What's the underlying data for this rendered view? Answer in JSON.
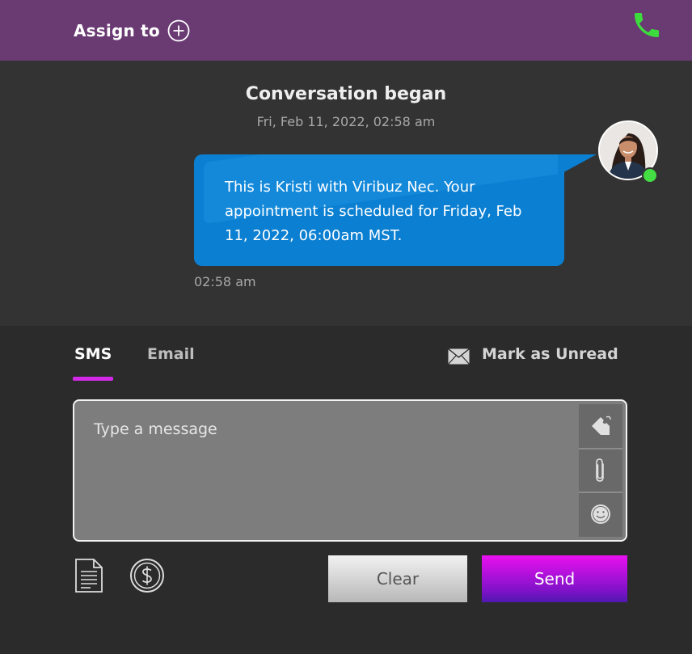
{
  "header": {
    "assign_label": "Assign to",
    "add_icon": "plus-circle-icon",
    "call_icon": "phone-icon",
    "call_color": "#3ddc3d",
    "background": "#6a3a73"
  },
  "conversation": {
    "title": "Conversation began",
    "started_at": "Fri, Feb 11, 2022, 02:58 am",
    "messages": [
      {
        "text": "This is Kristi with Viribuz Nec. Your appointment is scheduled for Friday, Feb 11, 2022, 06:00am MST.",
        "time": "02:58 am",
        "bubble_color": "#0b7fd1",
        "sender_status": "online"
      }
    ]
  },
  "composer": {
    "tabs": [
      {
        "label": "SMS",
        "active": true
      },
      {
        "label": "Email",
        "active": false
      }
    ],
    "mark_unread_label": "Mark as Unread",
    "message_value": "",
    "message_placeholder": "Type a message",
    "side_tools": [
      "tag-icon",
      "paperclip-icon",
      "emoji-icon"
    ],
    "bottom_tools": [
      "document-icon",
      "dollar-icon"
    ],
    "clear_label": "Clear",
    "send_label": "Send",
    "accent_color": "#d428e8"
  }
}
